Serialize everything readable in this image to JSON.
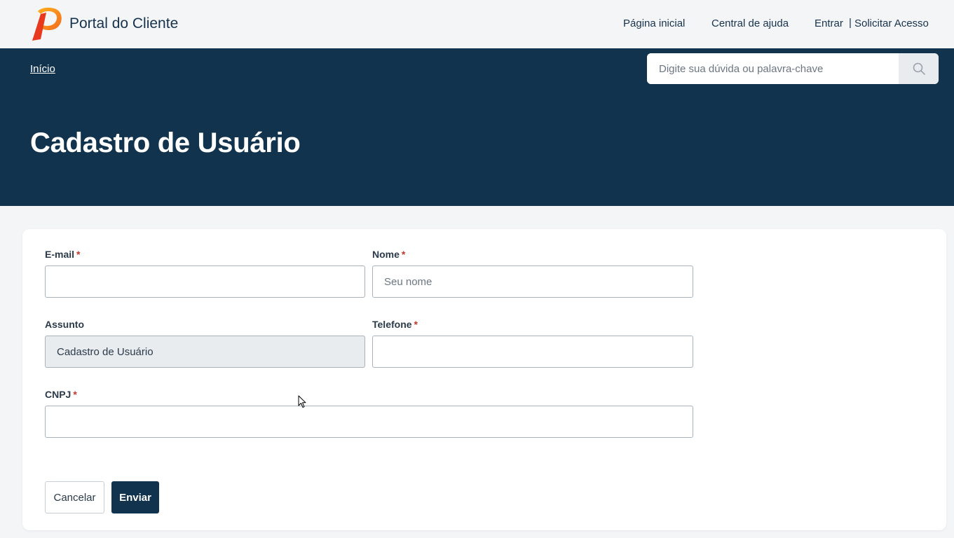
{
  "header": {
    "brand": "Portal do Cliente",
    "nav": {
      "home": "Página inicial",
      "help": "Central de ajuda",
      "login": "Entrar",
      "separator": "|",
      "request_access": "Solicitar Acesso"
    }
  },
  "hero": {
    "breadcrumb": "Início",
    "search_placeholder": "Digite sua dúvida ou palavra-chave",
    "title": "Cadastro de Usuário"
  },
  "form": {
    "required_mark": "*",
    "email": {
      "label": "E-mail",
      "value": "",
      "placeholder": ""
    },
    "nome": {
      "label": "Nome",
      "value": "",
      "placeholder": "Seu nome"
    },
    "assunto": {
      "label": "Assunto",
      "value": "Cadastro de Usuário"
    },
    "telefone": {
      "label": "Telefone",
      "value": ""
    },
    "cnpj": {
      "label": "CNPJ",
      "value": ""
    },
    "cancel_label": "Cancelar",
    "submit_label": "Enviar"
  },
  "colors": {
    "brand_dark": "#12334d",
    "required": "#c0392b",
    "logo_orange": "#f5821f",
    "logo_red": "#e8381d"
  },
  "icons": {
    "logo": "portal-p-logo",
    "search": "search-icon",
    "cursor": "mouse-pointer"
  }
}
